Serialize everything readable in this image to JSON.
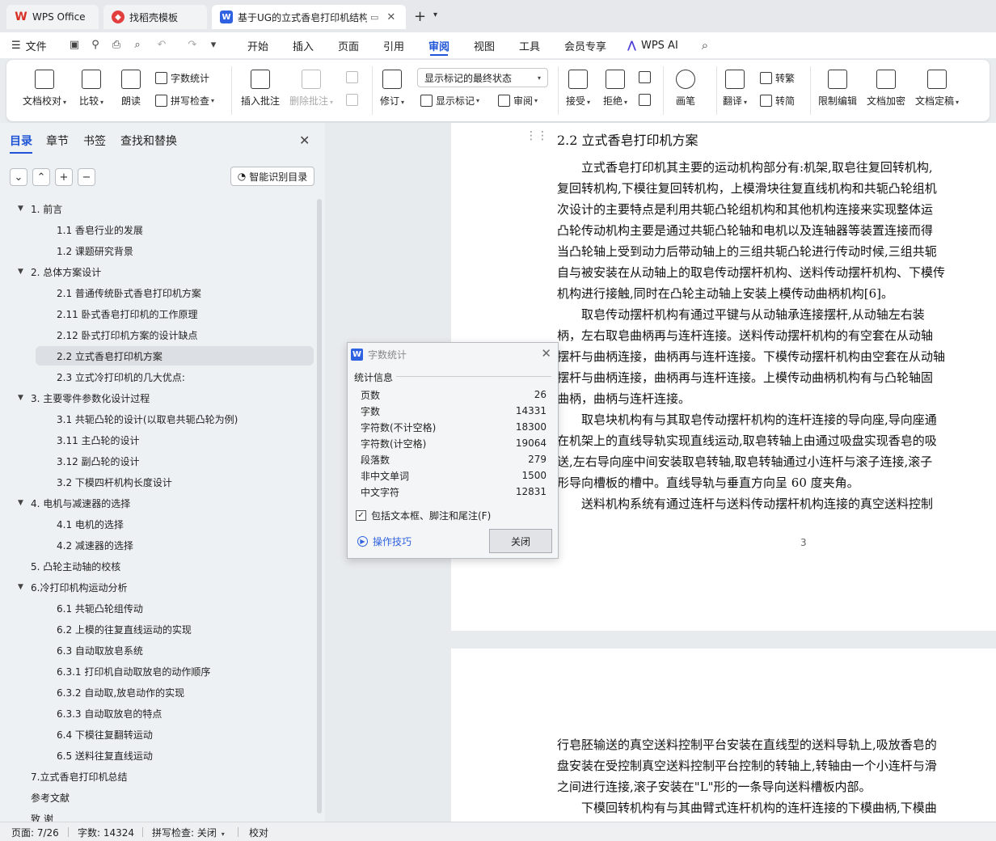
{
  "titlebar": {
    "tabs": [
      {
        "label": "WPS Office"
      },
      {
        "label": "找稻壳模板"
      },
      {
        "label": "基于UG的立式香皂打印机结构"
      }
    ]
  },
  "menubar": {
    "file": "文件",
    "items": [
      "开始",
      "插入",
      "页面",
      "引用",
      "审阅",
      "视图",
      "工具",
      "会员专享"
    ],
    "active": "审阅",
    "ai": "WPS AI"
  },
  "ribbon": {
    "doc_check": "文档校对",
    "compare": "比较",
    "read_aloud": "朗读",
    "word_count": "字数统计",
    "spell_check": "拼写检查",
    "insert_comment": "插入批注",
    "delete_comment": "删除批注",
    "revise": "修订",
    "markup_state": "显示标记的最终状态",
    "show_markup": "显示标记",
    "review_pane": "审阅",
    "accept": "接受",
    "reject": "拒绝",
    "pen": "画笔",
    "translate": "翻译",
    "to_traditional": "转繁",
    "to_simplified": "转简",
    "restrict_edit": "限制编辑",
    "encrypt": "文档加密",
    "finalize": "文档定稿"
  },
  "sidebar": {
    "tabs": [
      "目录",
      "章节",
      "书签",
      "查找和替换"
    ],
    "smart_toc": "智能识别目录",
    "toc": [
      {
        "label": "1. 前言",
        "level": 1,
        "arrow": true
      },
      {
        "label": "1.1 香皂行业的发展",
        "level": 2
      },
      {
        "label": "1.2 课题研究背景",
        "level": 2
      },
      {
        "label": "2. 总体方案设计",
        "level": 1,
        "arrow": true
      },
      {
        "label": "2.1 普通传统卧式香皂打印机方案",
        "level": 2
      },
      {
        "label": "2.11 卧式香皂打印机的工作原理",
        "level": 2
      },
      {
        "label": "2.12 卧式打印机方案的设计缺点",
        "level": 2
      },
      {
        "label": "2.2 立式香皂打印机方案",
        "level": 2,
        "selected": true
      },
      {
        "label": "2.3 立式冷打印机的几大优点:",
        "level": 2
      },
      {
        "label": "3. 主要零件参数化设计过程",
        "level": 1,
        "arrow": true
      },
      {
        "label": "3.1 共轭凸轮的设计(以取皂共轭凸轮为例)",
        "level": 2
      },
      {
        "label": "3.11 主凸轮的设计",
        "level": 2
      },
      {
        "label": "3.12 副凸轮的设计",
        "level": 2
      },
      {
        "label": "3.2 下模四杆机构长度设计",
        "level": 2
      },
      {
        "label": "4. 电机与减速器的选择",
        "level": 1,
        "arrow": true
      },
      {
        "label": "4.1 电机的选择",
        "level": 2
      },
      {
        "label": "4.2 减速器的选择",
        "level": 2
      },
      {
        "label": "5. 凸轮主动轴的校核",
        "level": 1,
        "arrow": false
      },
      {
        "label": "6.冷打印机构运动分析",
        "level": 1,
        "arrow": true
      },
      {
        "label": "6.1 共轭凸轮组传动",
        "level": 2
      },
      {
        "label": "6.2 上模的往复直线运动的实现",
        "level": 2
      },
      {
        "label": "6.3 自动取放皂系统",
        "level": 2
      },
      {
        "label": "6.3.1 打印机自动取放皂的动作顺序",
        "level": 2
      },
      {
        "label": "6.3.2 自动取,放皂动作的实现",
        "level": 2
      },
      {
        "label": "6.3.3 自动取放皂的特点",
        "level": 2
      },
      {
        "label": "6.4 下模往复翻转运动",
        "level": 2
      },
      {
        "label": "6.5 送料往复直线运动",
        "level": 2
      },
      {
        "label": "7.立式香皂打印机总结",
        "level": 1,
        "arrow": false
      },
      {
        "label": "参考文献",
        "level": 1,
        "arrow": false
      },
      {
        "label": "致 谢",
        "level": 1,
        "arrow": false
      }
    ]
  },
  "document": {
    "heading": "2.2 立式香皂打印机方案",
    "page1_lines": [
      "　　立式香皂打印机其主要的运动机构部分有:机架,取皂往复回转机构,",
      "复回转机构,下模往复回转机构，上模滑块往复直线机构和共轭凸轮组机",
      "次设计的主要特点是利用共轭凸轮组机构和其他机构连接来实现整体运",
      "凸轮传动机构主要是通过共轭凸轮轴和电机以及连轴器等装置连接而得",
      "当凸轮轴上受到动力后带动轴上的三组共轭凸轮进行传动时候,三组共轭",
      "自与被安装在从动轴上的取皂传动摆杆机构、送料传动摆杆机构、下模传",
      "机构进行接触,同时在凸轮主动轴上安装上模传动曲柄机构[6]。",
      "　　取皂传动摆杆机构有通过平键与从动轴承连接摆杆,从动轴左右装",
      "柄，左右取皂曲柄再与连杆连接。送料传动摆杆机构的有空套在从动轴",
      "摆杆与曲柄连接，曲柄再与连杆连接。下模传动摆杆机构由空套在从动轴",
      "摆杆与曲柄连接，曲柄再与连杆连接。上模传动曲柄机构有与凸轮轴固",
      "曲柄，曲柄与连杆连接。",
      "　　取皂块机构有与其取皂传动摆杆机构的连杆连接的导向座,导向座通",
      "在机架上的直线导轨实现直线运动,取皂转轴上由通过吸盘实现香皂的吸",
      "送,左右导向座中间安装取皂转轴,取皂转轴通过小连杆与滚子连接,滚子",
      "形导向槽板的槽中。直线导轨与垂直方向呈 60 度夹角。",
      "　　送料机构系统有通过连杆与送料传动摆杆机构连接的真空送料控制"
    ],
    "page_number": "3",
    "page2_lines": [
      "行皂胚输送的真空送料控制平台安装在直线型的送料导轨上,吸放香皂的",
      "盘安装在受控制真空送料控制平台控制的转轴上,转轴由一个小连杆与滑",
      "之间进行连接,滚子安装在\"L\"形的一条导向送料槽板内部。",
      "　　下模回转机构有与其曲臂式连杆机构的连杆连接的下模曲柄,下模曲"
    ]
  },
  "dialog": {
    "title": "字数统计",
    "section": "统计信息",
    "stats": [
      {
        "label": "页数",
        "value": "26"
      },
      {
        "label": "字数",
        "value": "14331"
      },
      {
        "label": "字符数(不计空格)",
        "value": "18300"
      },
      {
        "label": "字符数(计空格)",
        "value": "19064"
      },
      {
        "label": "段落数",
        "value": "279"
      },
      {
        "label": "非中文单词",
        "value": "1500"
      },
      {
        "label": "中文字符",
        "value": "12831"
      }
    ],
    "checkbox": "包括文本框、脚注和尾注(F)",
    "checked": true,
    "tips": "操作技巧",
    "close": "关闭"
  },
  "statusbar": {
    "page": "页面: 7/26",
    "words": "字数: 14324",
    "spell": "拼写检查: 关闭",
    "proof": "校对"
  },
  "colors": {
    "accent": "#1f55d6",
    "wps_red": "#d93025",
    "doc_icon": "#2f62e0"
  }
}
